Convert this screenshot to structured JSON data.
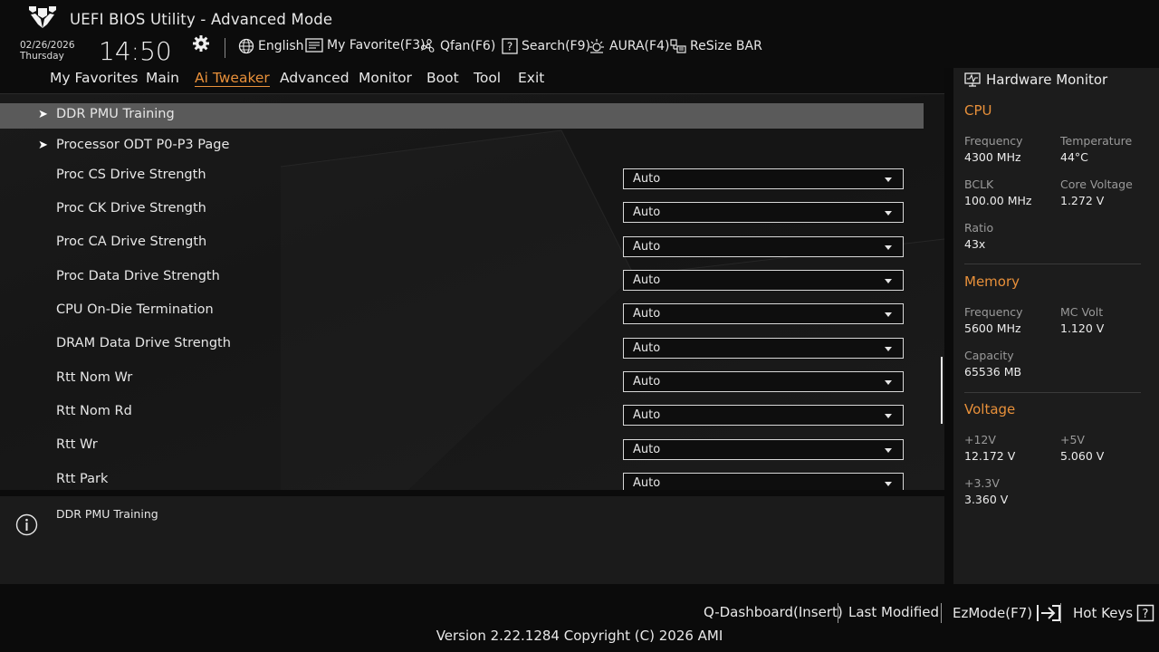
{
  "header": {
    "app_title": "UEFI BIOS Utility - Advanced Mode",
    "date": "02/26/2026",
    "weekday": "Thursday",
    "time": "14:50",
    "tools": {
      "language": "English",
      "my_favorite": "My Favorite(F3)",
      "qfan": "Qfan(F6)",
      "search": "Search(F9)",
      "aura": "AURA(F4)",
      "resize_bar": "ReSize BAR"
    }
  },
  "nav": {
    "items": [
      "My Favorites",
      "Main",
      "Ai Tweaker",
      "Advanced",
      "Monitor",
      "Boot",
      "Tool",
      "Exit"
    ],
    "active": "Ai Tweaker"
  },
  "settings": {
    "submenus": [
      "DDR PMU Training",
      "Processor ODT P0-P3 Page"
    ],
    "selected": "DDR PMU Training",
    "items": [
      {
        "label": "Proc CS Drive Strength",
        "value": "Auto"
      },
      {
        "label": "Proc CK Drive Strength",
        "value": "Auto"
      },
      {
        "label": "Proc CA Drive Strength",
        "value": "Auto"
      },
      {
        "label": "Proc Data Drive Strength",
        "value": "Auto"
      },
      {
        "label": "CPU On-Die Termination",
        "value": "Auto"
      },
      {
        "label": "DRAM Data Drive Strength",
        "value": "Auto"
      },
      {
        "label": "Rtt Nom Wr",
        "value": "Auto"
      },
      {
        "label": "Rtt Nom Rd",
        "value": "Auto"
      },
      {
        "label": "Rtt Wr",
        "value": "Auto"
      },
      {
        "label": "Rtt Park",
        "value": "Auto"
      }
    ]
  },
  "help": {
    "text": "DDR PMU Training"
  },
  "hardware_monitor": {
    "title": "Hardware Monitor",
    "cpu": {
      "heading": "CPU",
      "frequency_label": "Frequency",
      "frequency": "4300 MHz",
      "temperature_label": "Temperature",
      "temperature": "44°C",
      "bclk_label": "BCLK",
      "bclk": "100.00 MHz",
      "core_voltage_label": "Core Voltage",
      "core_voltage": "1.272 V",
      "ratio_label": "Ratio",
      "ratio": "43x"
    },
    "memory": {
      "heading": "Memory",
      "frequency_label": "Frequency",
      "frequency": "5600 MHz",
      "mc_volt_label": "MC Volt",
      "mc_volt": "1.120 V",
      "capacity_label": "Capacity",
      "capacity": "65536 MB"
    },
    "voltage": {
      "heading": "Voltage",
      "v12_label": "+12V",
      "v12": "12.172 V",
      "v5_label": "+5V",
      "v5": "5.060 V",
      "v33_label": "+3.3V",
      "v33": "3.360 V"
    }
  },
  "footer": {
    "qdashboard": "Q-Dashboard(Insert)",
    "last_modified": "Last Modified",
    "ezmode": "EzMode(F7)",
    "hotkeys": "Hot Keys",
    "version": "Version 2.22.1284 Copyright (C) 2026 AMI"
  },
  "colors": {
    "accent": "#e8903a",
    "selected_row": "#5a5a5a",
    "background": "#0b0b0b"
  },
  "icons": [
    "tuf-logo",
    "gear-icon",
    "globe-icon",
    "my-favorite-icon",
    "fan-icon",
    "search-icon",
    "aura-icon",
    "resize-bar-icon",
    "info-icon",
    "hardware-monitor-icon",
    "ezmode-exit-icon",
    "help-icon"
  ]
}
